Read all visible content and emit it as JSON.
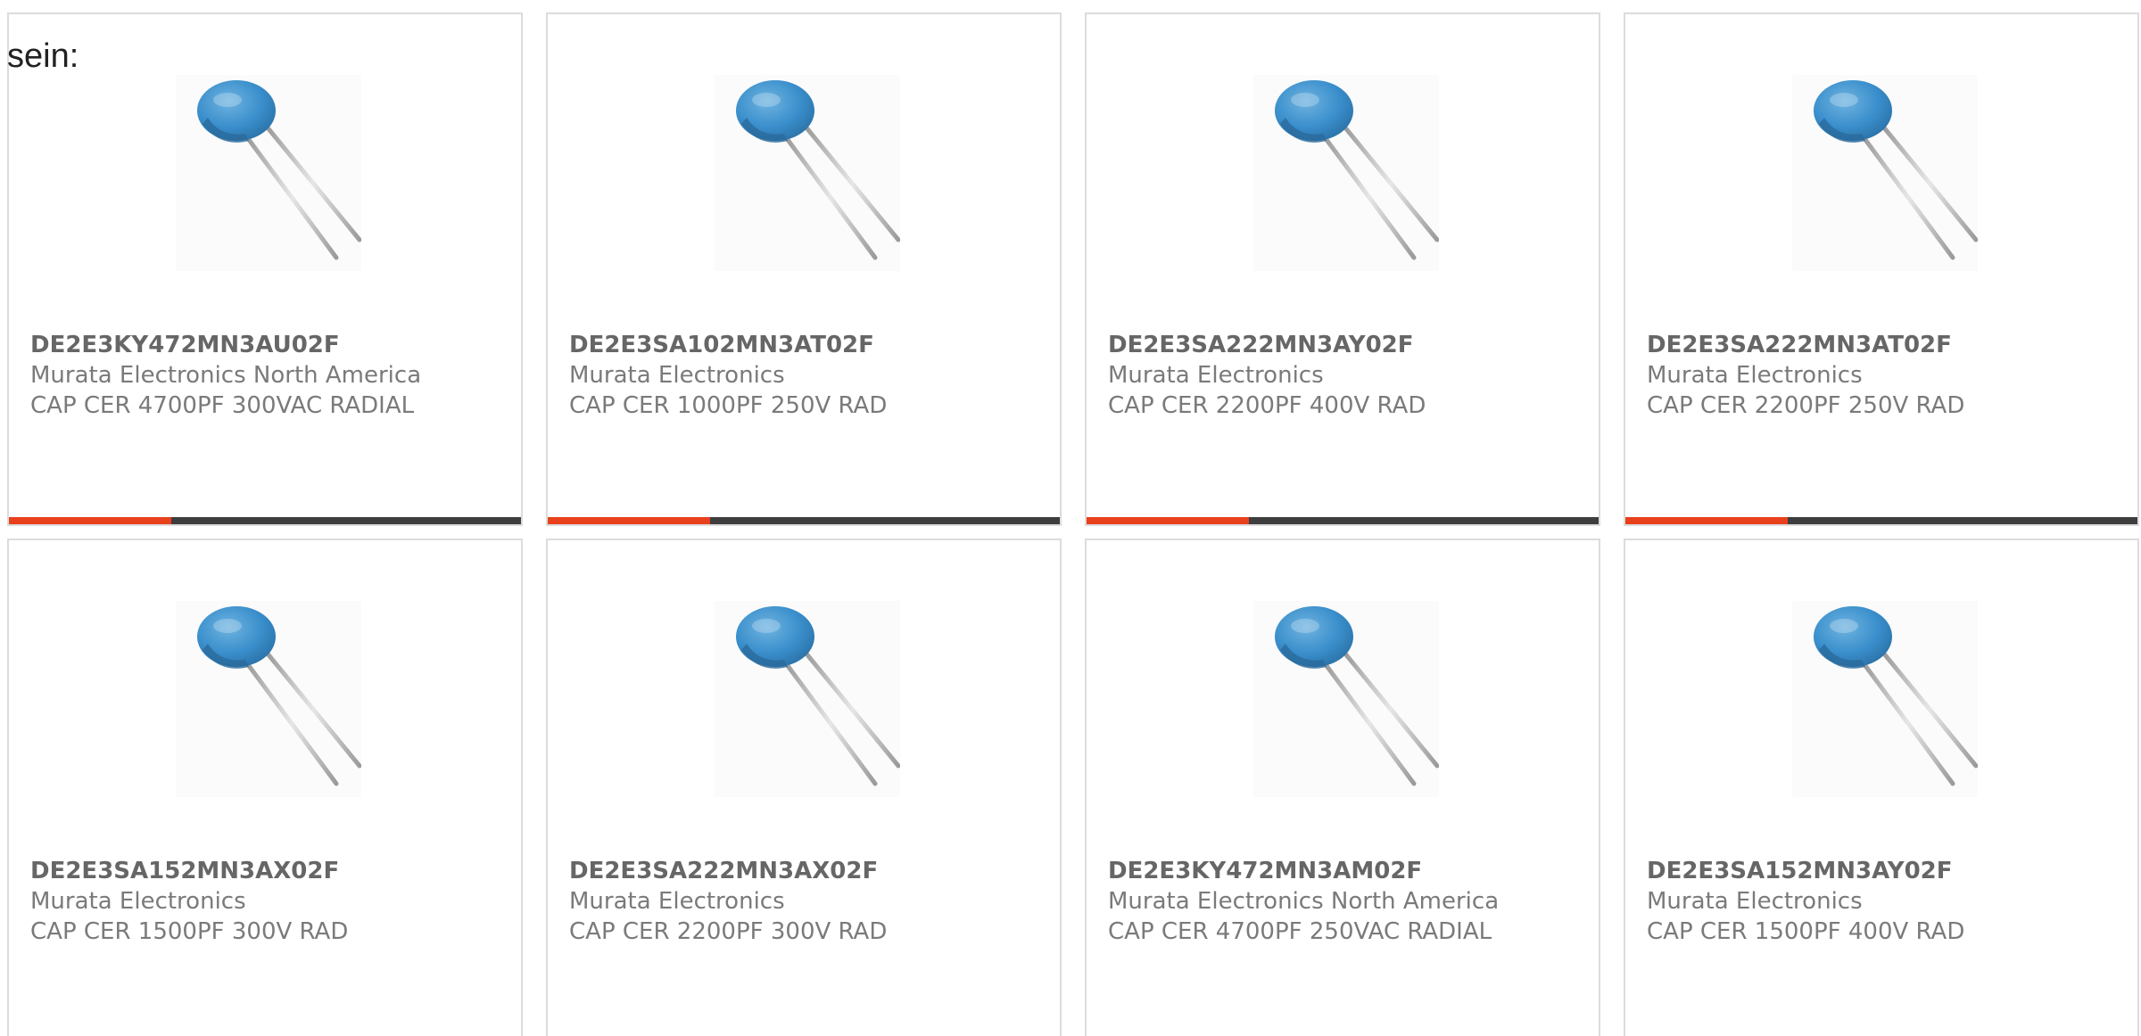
{
  "intro_text": "sein:",
  "accent_color": "#e8401c",
  "products": [
    {
      "part_number": "DE2E3KY472MN3AU02F",
      "manufacturer": "Murata Electronics North America",
      "description": "CAP CER 4700PF 300VAC RADIAL",
      "image_icon": "ceramic-capacitor-image"
    },
    {
      "part_number": "DE2E3SA102MN3AT02F",
      "manufacturer": "Murata Electronics",
      "description": "CAP CER 1000PF 250V RAD",
      "image_icon": "ceramic-capacitor-image"
    },
    {
      "part_number": "DE2E3SA222MN3AY02F",
      "manufacturer": "Murata Electronics",
      "description": "CAP CER 2200PF 400V RAD",
      "image_icon": "ceramic-capacitor-image"
    },
    {
      "part_number": "DE2E3SA222MN3AT02F",
      "manufacturer": "Murata Electronics",
      "description": "CAP CER 2200PF 250V RAD",
      "image_icon": "ceramic-capacitor-image"
    },
    {
      "part_number": "DE2E3SA152MN3AX02F",
      "manufacturer": "Murata Electronics",
      "description": "CAP CER 1500PF 300V RAD",
      "image_icon": "ceramic-capacitor-image"
    },
    {
      "part_number": "DE2E3SA222MN3AX02F",
      "manufacturer": "Murata Electronics",
      "description": "CAP CER 2200PF 300V RAD",
      "image_icon": "ceramic-capacitor-image"
    },
    {
      "part_number": "DE2E3KY472MN3AM02F",
      "manufacturer": "Murata Electronics North America",
      "description": "CAP CER 4700PF 250VAC RADIAL",
      "image_icon": "ceramic-capacitor-image"
    },
    {
      "part_number": "DE2E3SA152MN3AY02F",
      "manufacturer": "Murata Electronics",
      "description": "CAP CER 1500PF 400V RAD",
      "image_icon": "ceramic-capacitor-image"
    }
  ]
}
